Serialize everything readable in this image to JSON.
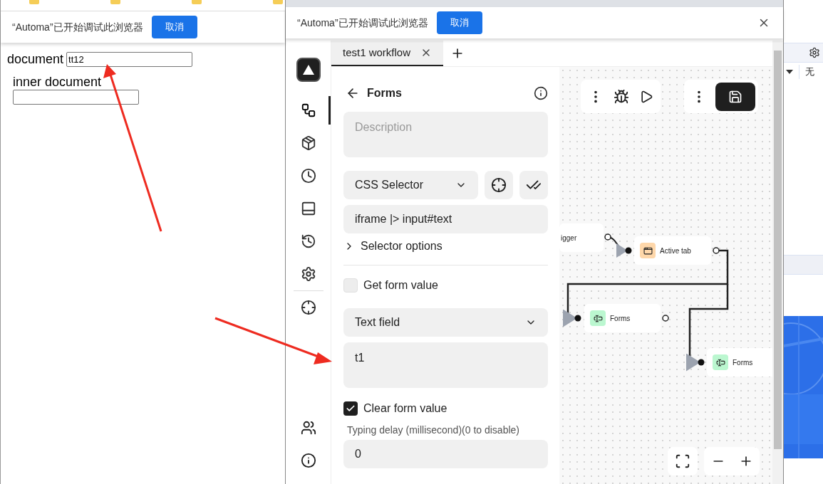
{
  "page_infobar": {
    "message": "“Automa”已开始调试此浏览器",
    "button": "取消"
  },
  "page_fields": [
    {
      "label": "document",
      "value": "tt12"
    },
    {
      "label": "inner document"
    }
  ],
  "popup_infobar": {
    "message": "“Automa”已开始调试此浏览器",
    "button": "取消"
  },
  "tabs": [
    {
      "label": "test1 workflow",
      "selected": true
    }
  ],
  "sidebar": {
    "items": [
      {
        "selected": true
      },
      {
        "selected": false
      },
      {
        "selected": false
      },
      {
        "selected": false
      },
      {
        "selected": false
      },
      {
        "selected": false
      },
      {
        "selected": false
      }
    ]
  },
  "editor": {
    "title": "Forms",
    "description_placeholder": "Description",
    "selector_type": "CSS Selector",
    "selector": "iframe |> input#text",
    "selector_options": {
      "label": "Selector options",
      "expanded": false
    },
    "get_form_value": {
      "label": "Get form value",
      "checked": false
    },
    "field_type": "Text field",
    "value": "t1",
    "clear_form_value": {
      "label": "Clear form value",
      "checked": true
    },
    "typing_delay": {
      "label": "Typing delay (millisecond)(0 to disable)",
      "value": "0"
    }
  },
  "canvas_nodes": [
    {
      "kind": "trigger",
      "label": "igger"
    },
    {
      "kind": "tab",
      "label": "Active tab",
      "color": "#fed7aa"
    },
    {
      "kind": "form",
      "label": "Forms",
      "color": "#bbf7d0"
    },
    {
      "kind": "form",
      "label": "Forms",
      "color": "#bbf7d0"
    }
  ],
  "right_strip": {
    "text": "无"
  }
}
